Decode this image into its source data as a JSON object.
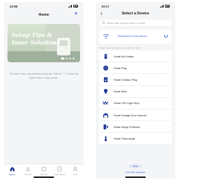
{
  "left": {
    "status": {
      "time": "10:58"
    },
    "nav": {
      "title": "Home",
      "add_label": "+"
    },
    "banner": {
      "line1": "Setup Tips &",
      "line2": "Issue Solutions"
    },
    "empty_text": "You don't have any devices setup yet. Tap the \"+\" on the top right to add a new device.",
    "tabs": [
      {
        "label": "Home",
        "icon": "home-icon",
        "active": true
      },
      {
        "label": "Scenes",
        "icon": "scenes-icon",
        "active": false
      },
      {
        "label": "Groups",
        "icon": "groups-icon",
        "active": false
      },
      {
        "label": "Wall Panels",
        "icon": "panel-icon",
        "active": false
      },
      {
        "label": "Links",
        "icon": "user-icon",
        "active": false
      }
    ]
  },
  "right": {
    "status": {
      "time": "10:17"
    },
    "nav": {
      "back_label": "‹",
      "title": "Select a Device"
    },
    "search": {
      "placeholder": "Search with product name or model"
    },
    "scan": {
      "label": "Searching for local devices"
    },
    "hint": "Please select a device you would like to setup",
    "devices": [
      {
        "label": "Smart Air Purifier",
        "icon": "air-purifier-icon"
      },
      {
        "label": "Smart Plug",
        "icon": "plug-icon"
      },
      {
        "label": "Smart Outdoor Plug",
        "icon": "outdoor-plug-icon"
      },
      {
        "label": "Smart Bulb",
        "icon": "bulb-icon"
      },
      {
        "label": "Smart LED Light Strip",
        "icon": "light-strip-icon"
      },
      {
        "label": "Smart Garage Door Opener",
        "icon": "garage-icon"
      },
      {
        "label": "Smart Surge Protector",
        "icon": "surge-protector-icon"
      },
      {
        "label": "Smart Thermostat",
        "icon": "thermostat-icon"
      }
    ],
    "more_label": "More",
    "cant_find": "Can't find my device"
  },
  "colors": {
    "accent": "#3b5bdb",
    "background": "#f4f5f7",
    "tab_active": "#1f3a93"
  }
}
